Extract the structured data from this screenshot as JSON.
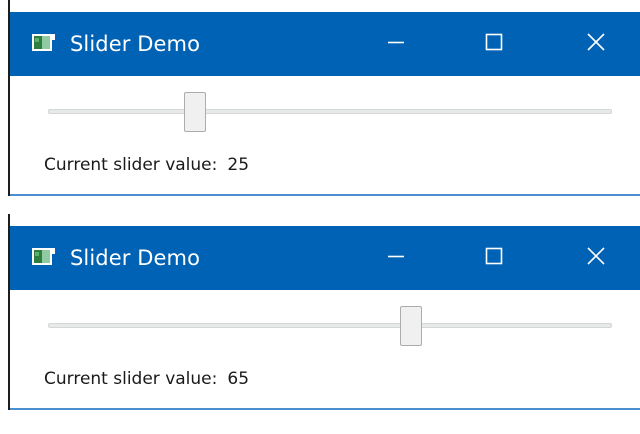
{
  "windows": [
    {
      "title": "Slider Demo",
      "slider": {
        "min": 0,
        "max": 100,
        "value": 25
      },
      "value_label": "Current slider value:",
      "value_text": "25"
    },
    {
      "title": "Slider Demo",
      "slider": {
        "min": 0,
        "max": 100,
        "value": 65
      },
      "value_label": "Current slider value:",
      "value_text": "65"
    }
  ],
  "colors": {
    "titlebar": "#0062b4",
    "window_border": "#4a8fd2",
    "title_text": "#ffffff"
  },
  "icons": {
    "app": "app-window-icon",
    "minimize": "minimize-icon",
    "maximize": "maximize-icon",
    "close": "close-icon"
  }
}
